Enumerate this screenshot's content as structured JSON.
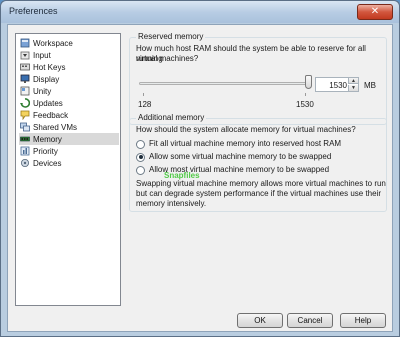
{
  "window": {
    "title": "Preferences",
    "close_glyph": "✕"
  },
  "sidebar": {
    "items": [
      {
        "label": "Workspace",
        "icon": "workspace-icon"
      },
      {
        "label": "Input",
        "icon": "input-icon"
      },
      {
        "label": "Hot Keys",
        "icon": "hotkeys-icon"
      },
      {
        "label": "Display",
        "icon": "display-icon"
      },
      {
        "label": "Unity",
        "icon": "unity-icon"
      },
      {
        "label": "Updates",
        "icon": "updates-icon"
      },
      {
        "label": "Feedback",
        "icon": "feedback-icon"
      },
      {
        "label": "Shared VMs",
        "icon": "shared-vms-icon"
      },
      {
        "label": "Memory",
        "icon": "memory-icon",
        "selected": true
      },
      {
        "label": "Priority",
        "icon": "priority-icon"
      },
      {
        "label": "Devices",
        "icon": "devices-icon"
      }
    ]
  },
  "reserved": {
    "title": "Reserved memory",
    "question_line1": "How much host RAM should the system be able to reserve for all running",
    "question_line2": "virtual machines?",
    "slider_min_label": "128",
    "slider_max_label": "1530",
    "slider_value_fraction": 1.0,
    "spin_value": "1530",
    "unit": "MB"
  },
  "additional": {
    "title": "Additional memory",
    "question": "How should the system allocate memory for virtual machines?",
    "options": [
      {
        "label": "Fit all virtual machine memory into reserved host RAM",
        "selected": false
      },
      {
        "label": "Allow some virtual machine memory to be swapped",
        "selected": true
      },
      {
        "label": "Allow most virtual machine memory to be swapped",
        "selected": false
      }
    ],
    "note_line1": "Swapping virtual machine memory allows more virtual machines to run",
    "note_line2": "but can degrade system performance if the virtual machines use their",
    "note_line3": "memory intensively."
  },
  "watermark": "Snapfiles",
  "buttons": {
    "ok": "OK",
    "cancel": "Cancel",
    "help": "Help"
  },
  "colors": {
    "accent": "#3399ff",
    "title_bar": "#b8cde4",
    "close": "#c13a20"
  }
}
